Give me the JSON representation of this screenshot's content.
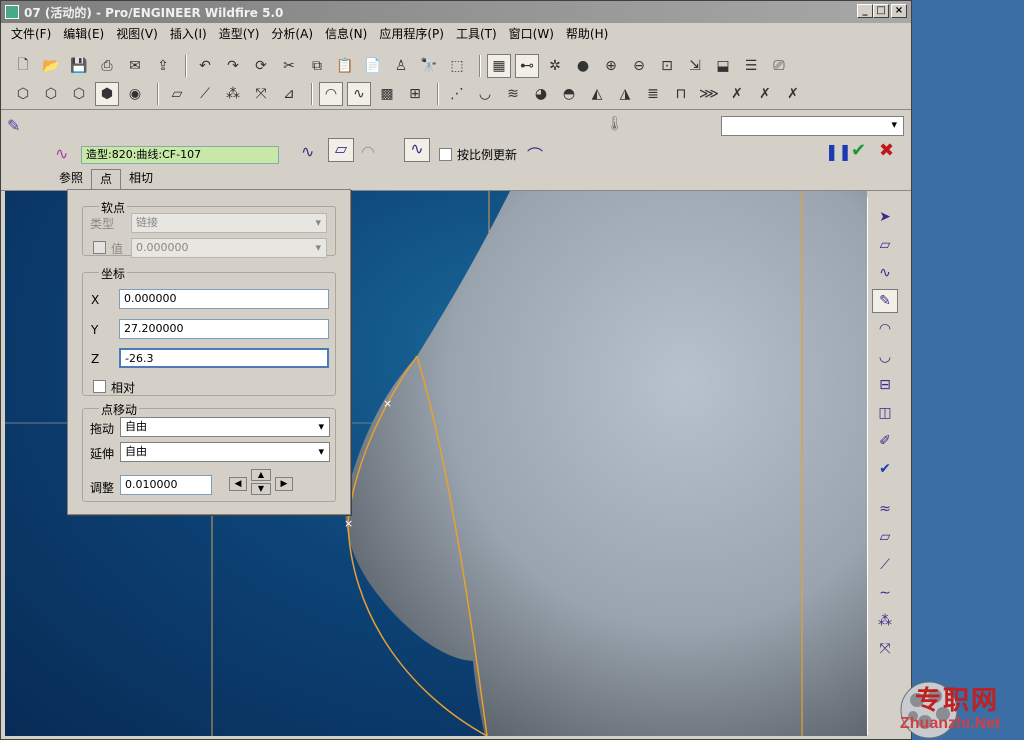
{
  "window": {
    "title": "07 (活动的) - Pro/ENGINEER Wildfire 5.0"
  },
  "menu": [
    "文件(F)",
    "编辑(E)",
    "视图(V)",
    "插入(I)",
    "造型(Y)",
    "分析(A)",
    "信息(N)",
    "应用程序(P)",
    "工具(T)",
    "窗口(W)",
    "帮助(H)"
  ],
  "dashboard": {
    "curve_field": "造型:820:曲线:CF-107",
    "ratio_update_label": "按比例更新",
    "tabs": [
      "参照",
      "点",
      "相切"
    ]
  },
  "point_panel": {
    "soft_point": {
      "title": "软点",
      "type_label": "类型",
      "type_value": "链接",
      "value_label": "值",
      "value_value": "0.000000"
    },
    "coords": {
      "title": "坐标",
      "x_label": "X",
      "x_value": "0.000000",
      "y_label": "Y",
      "y_value": "27.200000",
      "z_label": "Z",
      "z_value": "-26.3",
      "relative_label": "相对"
    },
    "move": {
      "title": "点移动",
      "drag_label": "拖动",
      "drag_value": "自由",
      "extend_label": "延伸",
      "extend_value": "自由",
      "adjust_label": "调整",
      "adjust_value": "0.010000"
    }
  },
  "watermark": {
    "cn": "专职网",
    "en": "Zhuanzhi.Net"
  }
}
